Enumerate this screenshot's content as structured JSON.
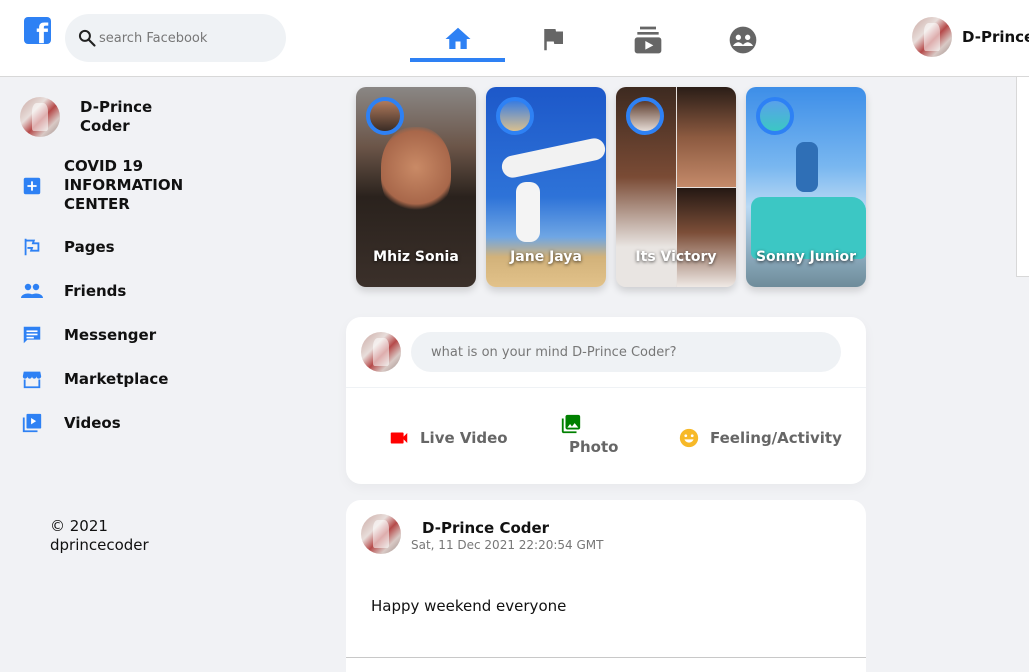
{
  "header": {
    "search_placeholder": "search Facebook",
    "user_name": "D-Prince",
    "nav": [
      {
        "icon": "home-icon",
        "active": true
      },
      {
        "icon": "flag-icon",
        "active": false
      },
      {
        "icon": "subscriptions-icon",
        "active": false
      },
      {
        "icon": "supervised-user-icon",
        "active": false
      }
    ]
  },
  "sidebar": {
    "user_name": "D-Prince Coder",
    "items": [
      {
        "label": "COVID 19 INFORMATION CENTER",
        "icon": "local-hospital-icon"
      },
      {
        "label": "Pages",
        "icon": "emoji-flags-icon"
      },
      {
        "label": "Friends",
        "icon": "people-icon"
      },
      {
        "label": "Messenger",
        "icon": "chat-icon"
      },
      {
        "label": "Marketplace",
        "icon": "storefront-icon"
      },
      {
        "label": "Videos",
        "icon": "video-library-icon"
      }
    ],
    "copyright": "© 2021 dprincecoder"
  },
  "stories": [
    {
      "name": "Mhiz Sonia"
    },
    {
      "name": "Jane Jaya"
    },
    {
      "name": "Its Victory"
    },
    {
      "name": "Sonny Junior"
    }
  ],
  "composer": {
    "placeholder": "what is on your mind D-Prince Coder?",
    "options": [
      {
        "label": "Live Video",
        "icon": "videocam-icon",
        "color": "#ff0000"
      },
      {
        "label": "Photo",
        "icon": "photo-library-icon",
        "color": "#008000"
      },
      {
        "label": "Feeling/Activity",
        "icon": "emoji-icon",
        "color": "#f7b928"
      }
    ]
  },
  "post": {
    "author": "D-Prince Coder",
    "timestamp": "Sat, 11 Dec 2021 22:20:54 GMT",
    "message": "Happy weekend everyone"
  },
  "colors": {
    "accent": "#2e81f4",
    "background": "#f1f2f5"
  }
}
